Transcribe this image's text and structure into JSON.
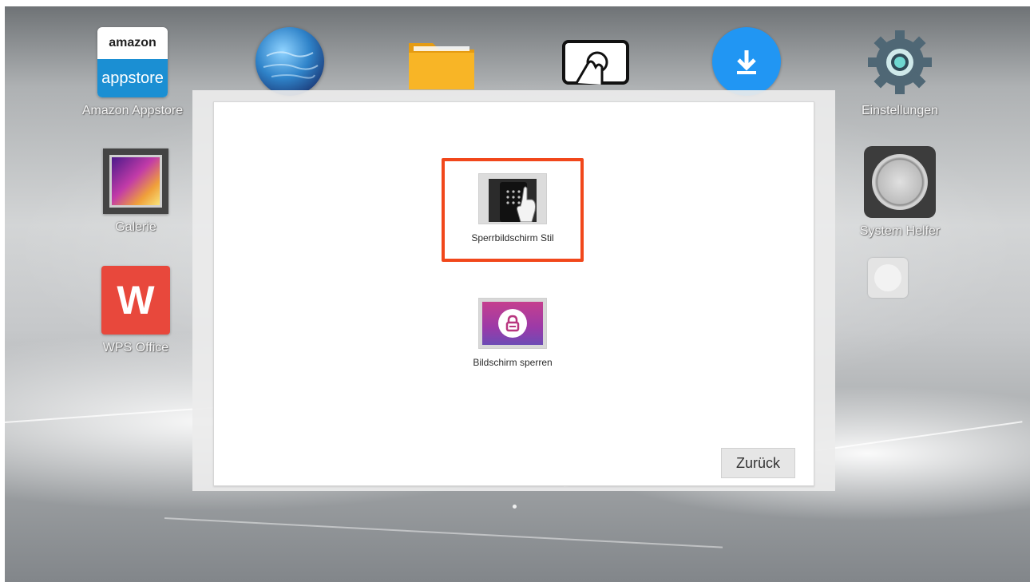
{
  "desktop": {
    "apps": [
      {
        "id": "amazon",
        "label": "Amazon Appstore",
        "icon": "amazon-appstore-icon",
        "logo_line1": "amazon",
        "logo_line2": "appstore"
      },
      {
        "id": "browser",
        "label": "",
        "icon": "globe-icon"
      },
      {
        "id": "files",
        "label": "",
        "icon": "folder-icon"
      },
      {
        "id": "touch",
        "label": "",
        "icon": "touch-screen-icon"
      },
      {
        "id": "download",
        "label": "",
        "icon": "download-icon"
      },
      {
        "id": "settings",
        "label": "Einstellungen",
        "icon": "gear-icon"
      },
      {
        "id": "gallery",
        "label": "Galerie",
        "icon": "gallery-icon"
      },
      {
        "id": "wps",
        "label": "WPS Office",
        "icon": "wps-office-icon",
        "logo": "W"
      },
      {
        "id": "helper",
        "label": "System Helfer",
        "icon": "system-helper-icon"
      }
    ]
  },
  "dialog": {
    "options": [
      {
        "label": "Sperrbildschirm Stil",
        "icon": "lockscreen-style-icon",
        "highlighted": true
      },
      {
        "label": "Bildschirm sperren",
        "icon": "lock-screen-icon",
        "highlighted": false
      }
    ],
    "back_label": "Zurück"
  },
  "colors": {
    "highlight": "#f1471b",
    "amazon_blue": "#1b8fd3",
    "wps_red": "#e8483c",
    "download_blue": "#2196f3"
  }
}
